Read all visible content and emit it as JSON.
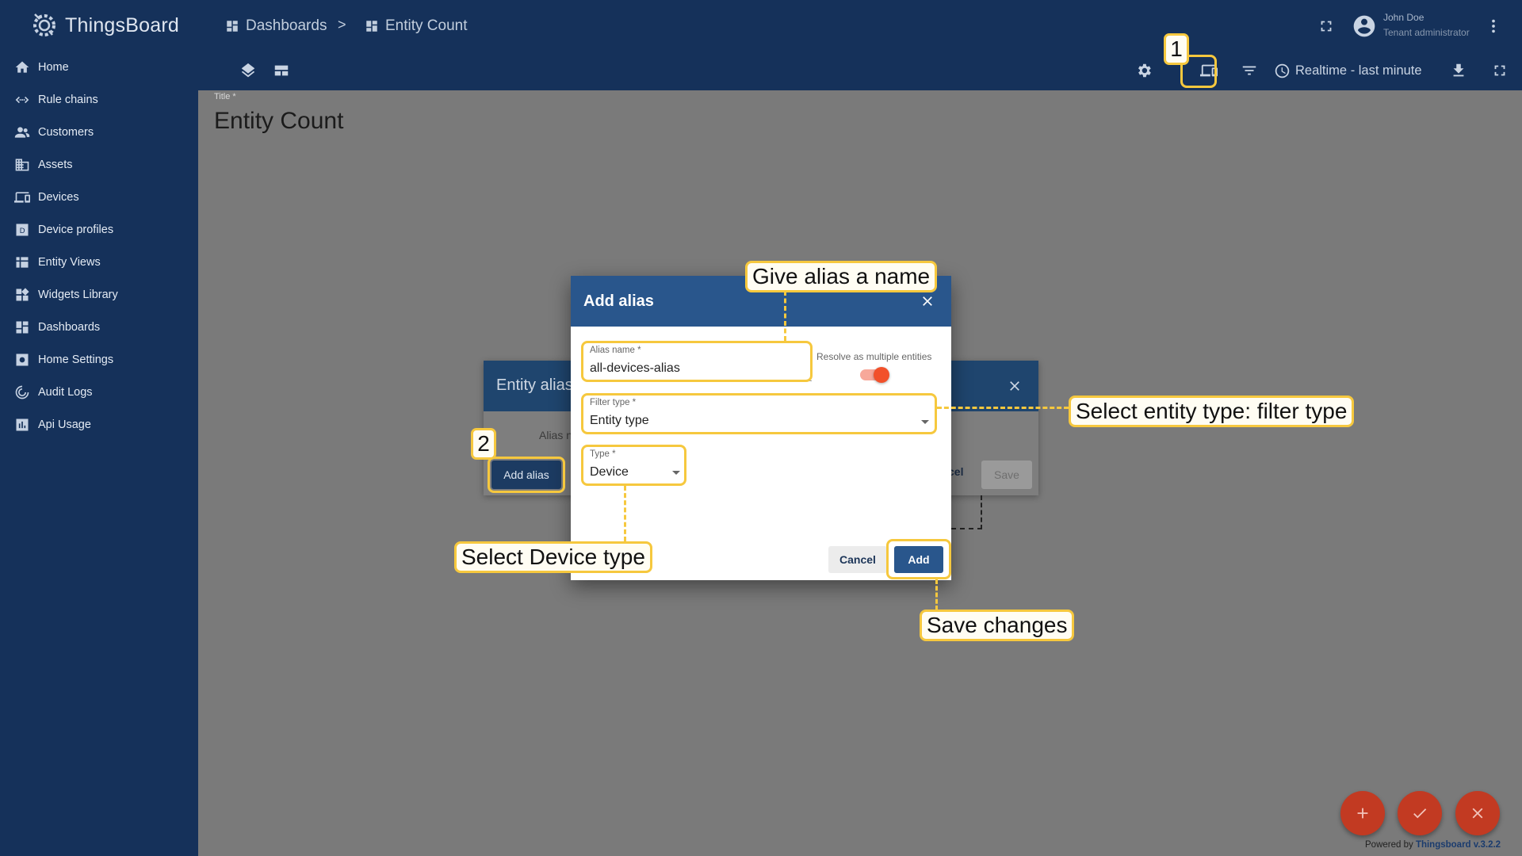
{
  "app": {
    "name": "ThingsBoard"
  },
  "sidebar": {
    "items": [
      {
        "label": "Home",
        "icon": "home-icon"
      },
      {
        "label": "Rule chains",
        "icon": "rule-chain-icon"
      },
      {
        "label": "Customers",
        "icon": "customers-icon"
      },
      {
        "label": "Assets",
        "icon": "assets-icon"
      },
      {
        "label": "Devices",
        "icon": "devices-icon"
      },
      {
        "label": "Device profiles",
        "icon": "device-profile-icon"
      },
      {
        "label": "Entity Views",
        "icon": "entity-views-icon"
      },
      {
        "label": "Widgets Library",
        "icon": "widgets-icon"
      },
      {
        "label": "Dashboards",
        "icon": "dashboards-icon"
      },
      {
        "label": "Home Settings",
        "icon": "settings-icon"
      },
      {
        "label": "Audit Logs",
        "icon": "audit-icon"
      },
      {
        "label": "Api Usage",
        "icon": "api-usage-icon"
      }
    ]
  },
  "breadcrumb": {
    "first": "Dashboards",
    "separator": ">",
    "second": "Entity Count"
  },
  "user": {
    "name": "John Doe",
    "role": "Tenant administrator"
  },
  "toolbar": {
    "timewindow": "Realtime - last minute"
  },
  "main": {
    "title_label": "Title *",
    "title": "Entity Count"
  },
  "footer": {
    "powered_prefix": "Powered by",
    "powered_link": "Thingsboard v.3.2.2"
  },
  "entity_aliases_dialog": {
    "title": "Entity alias",
    "column_header": "Alias n",
    "add_button": "Add alias",
    "cancel_button": "cel",
    "save_button": "Save"
  },
  "add_alias_dialog": {
    "title": "Add alias",
    "alias_name_label": "Alias name *",
    "alias_name_value": "all-devices-alias",
    "resolve_label": "Resolve as multiple entities",
    "resolve_checked": true,
    "filter_type_label": "Filter type *",
    "filter_type_value": "Entity type",
    "type_label": "Type *",
    "type_value": "Device",
    "cancel_button": "Cancel",
    "add_button": "Add"
  },
  "annotations": {
    "step1": "1",
    "step2": "2",
    "give_name": "Give alias a name",
    "select_entity": "Select entity type: filter type",
    "select_device": "Select Device type",
    "save_changes": "Save changes"
  },
  "colors": {
    "sidebar": "#15315a",
    "dialog_header": "#29568c",
    "accent": "#f2502a",
    "annotation": "#f6c83e",
    "fab": "#c23a22"
  }
}
